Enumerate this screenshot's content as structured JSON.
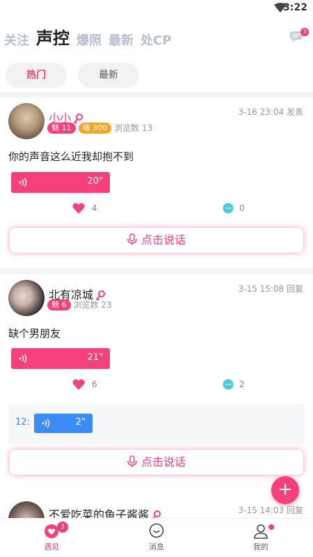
{
  "status": {
    "time": "3:22"
  },
  "topnav": {
    "tabs": [
      {
        "label": "关注"
      },
      {
        "label": "声控"
      },
      {
        "label": "爆照"
      },
      {
        "label": "最新"
      },
      {
        "label": "处CP"
      }
    ],
    "message_badge": "3"
  },
  "subtabs": [
    {
      "label": "热门"
    },
    {
      "label": "最新"
    }
  ],
  "posts": [
    {
      "name": "小小",
      "tags": [
        "魅 11",
        "壕 300"
      ],
      "views": "浏览数 13",
      "time": "3-16 23:04 发表",
      "content": "你的声音这么近我却抱不到",
      "voice_duration": "20\"",
      "likes": "4",
      "comments": "0",
      "speak_label": "点击说话"
    },
    {
      "name": "北有凉城",
      "tags": [
        "魅 6"
      ],
      "views": "浏览数 23",
      "time": "3-15 15:08 回复",
      "content": "缺个男朋友",
      "voice_duration": "21\"",
      "likes": "6",
      "comments": "2",
      "reply": {
        "num": "12:",
        "duration": "2\""
      },
      "speak_label": "点击说话"
    },
    {
      "name": "不爱吃菜的鱼子酱酱",
      "time": "3-15 14:03 回复"
    }
  ],
  "fab_label": "+",
  "bottom_nav": {
    "items": [
      {
        "label": "遇见",
        "badge": "3"
      },
      {
        "label": "消息"
      },
      {
        "label": "我的"
      }
    ]
  },
  "colors": {
    "accent": "#f4417c",
    "blue": "#3c8cf5",
    "orange": "#f6a623"
  }
}
